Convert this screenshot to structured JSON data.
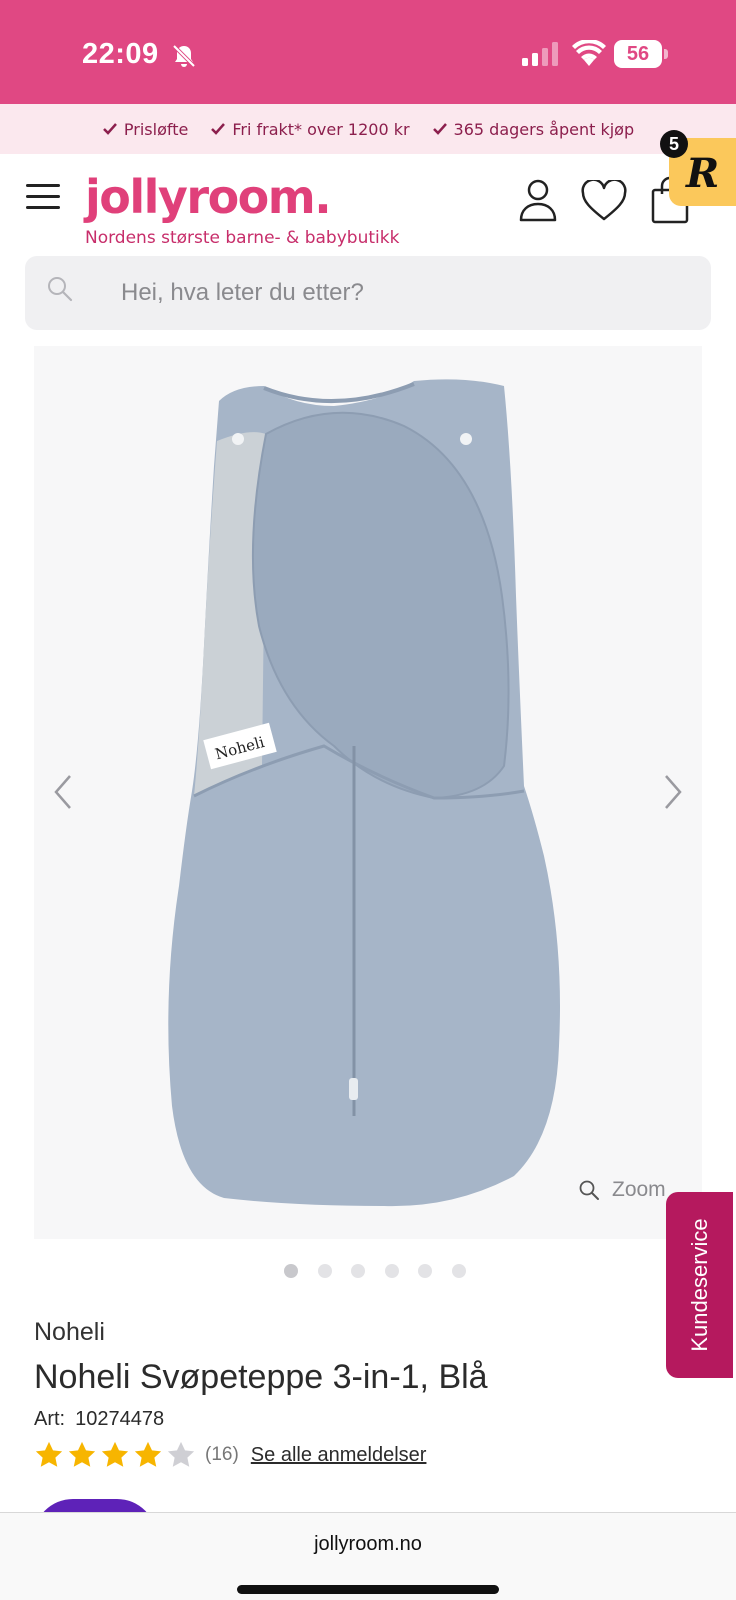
{
  "status_bar": {
    "time": "22:09",
    "battery": "56",
    "icons": [
      "bell-slash-icon",
      "cellular-signal-icon",
      "wifi-icon",
      "battery-icon"
    ]
  },
  "promo": {
    "items": [
      "Prisløfte",
      "Fri frakt* over 1200 kr",
      "365 dagers åpent kjøp"
    ]
  },
  "header": {
    "logo": "jollyroom.",
    "tagline": "Nordens største barne- & babybutikk",
    "extension_letter": "R",
    "extension_count": "5",
    "icons": [
      "menu-icon",
      "user-icon",
      "heart-icon",
      "bag-icon"
    ]
  },
  "search": {
    "placeholder": "Hei, hva leter du etter?"
  },
  "gallery": {
    "image_label": "Noheli",
    "zoom_label": "Zoom",
    "image_count": 6,
    "active_index": 0
  },
  "side_tab": {
    "label": "Kundeservice"
  },
  "product": {
    "brand": "Noheli",
    "title": "Noheli Svøpeteppe 3-in-1, Blå",
    "art_label": "Art:",
    "art_number": "10274478",
    "rating": 4,
    "rating_max": 5,
    "review_count": "(16)",
    "reviews_link": "Se alle anmeldelser"
  },
  "browser": {
    "url": "jollyroom.no"
  },
  "colors": {
    "brand_pink": "#e04883",
    "logo_pink": "#e0407a",
    "promo_bg": "#fbe8ee",
    "service_tab": "#b5195e",
    "star": "#f7b500",
    "cta_purple": "#5e22b8"
  }
}
